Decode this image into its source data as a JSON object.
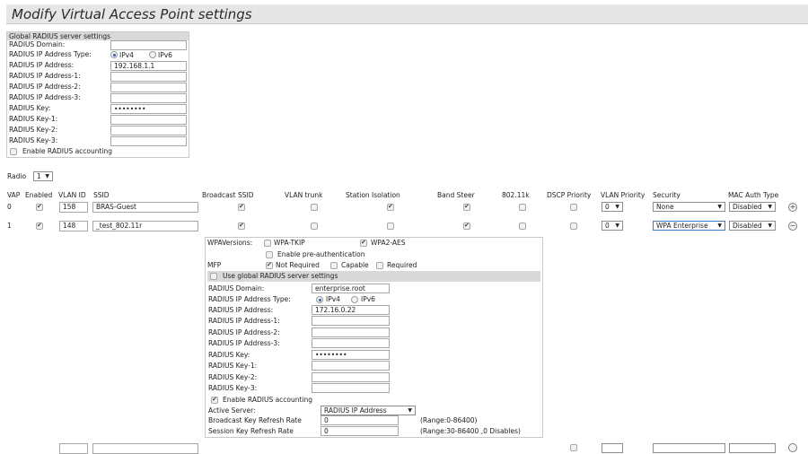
{
  "page_title": "Modify Virtual Access Point settings",
  "global": {
    "header": "Global RADIUS server settings",
    "domain_label": "RADIUS Domain:",
    "ip_type_label": "RADIUS IP Address Type:",
    "ipv4": "IPv4",
    "ipv6": "IPv6",
    "ip_label": "RADIUS IP Address:",
    "ip_value": "192.168.1.1",
    "ip1_label": "RADIUS IP Address-1:",
    "ip2_label": "RADIUS IP Address-2:",
    "ip3_label": "RADIUS IP Address-3:",
    "key_label": "RADIUS Key:",
    "key_value": "••••••••",
    "key1_label": "RADIUS Key-1:",
    "key2_label": "RADIUS Key-2:",
    "key3_label": "RADIUS Key-3:",
    "accounting_label": "Enable RADIUS accounting"
  },
  "radio": {
    "label": "Radio",
    "value": "1"
  },
  "columns": {
    "vap": "VAP",
    "enabled": "Enabled",
    "vlan_id": "VLAN ID",
    "ssid": "SSID",
    "broadcast_ssid": "Broadcast SSID",
    "vlan_trunk": "VLAN trunk",
    "station_isolation": "Station Isolation",
    "band_steer": "Band Steer",
    "r80211k": "802.11k",
    "dscp_priority": "DSCP Priority",
    "vlan_priority": "VLAN Priority",
    "security": "Security",
    "mac_auth_type": "MAC Auth Type"
  },
  "rows": [
    {
      "vap": "0",
      "vlan_id": "158",
      "ssid": "BRAS-Guest",
      "vlan_priority": "0",
      "security": "None",
      "mac_auth": "Disabled"
    },
    {
      "vap": "1",
      "vlan_id": "148",
      "ssid": "_test_802.11r",
      "vlan_priority": "0",
      "security": "WPA Enterprise",
      "mac_auth": "Disabled"
    }
  ],
  "wpa": {
    "versions_label": "WPAVersions:",
    "wpa_tkip": "WPA-TKIP",
    "wpa2_aes": "WPA2-AES",
    "preauth": "Enable pre-authentication",
    "mfp_label": "MFP",
    "not_required": "Not Required",
    "capable": "Capable",
    "required": "Required",
    "use_global": "Use global RADIUS server settings",
    "domain_label": "RADIUS Domain:",
    "domain_value": "enterprise.root",
    "ip_type_label": "RADIUS IP Address Type:",
    "ipv4": "IPv4",
    "ipv6": "IPv6",
    "ip_label": "RADIUS IP Address:",
    "ip_value": "172.16.0.22",
    "ip1_label": "RADIUS IP Address-1:",
    "ip2_label": "RADIUS IP Address-2:",
    "ip3_label": "RADIUS IP Address-3:",
    "key_label": "RADIUS Key:",
    "key_value": "••••••••",
    "key1_label": "RADIUS Key-1:",
    "key2_label": "RADIUS Key-2:",
    "key3_label": "RADIUS Key-3:",
    "accounting_label": "Enable RADIUS accounting",
    "active_server_label": "Active Server:",
    "active_server_value": "RADIUS IP Address",
    "bcast_label": "Broadcast Key Refresh Rate",
    "bcast_value": "0",
    "bcast_range": "(Range:0-86400)",
    "session_label": "Session Key Refresh Rate",
    "session_value": "0",
    "session_range": "(Range:30-86400 ,0 Disables)"
  },
  "icons": {
    "add": "plus-circle-icon",
    "remove": "minus-circle-icon",
    "dropdown": "chevron-down-icon"
  }
}
